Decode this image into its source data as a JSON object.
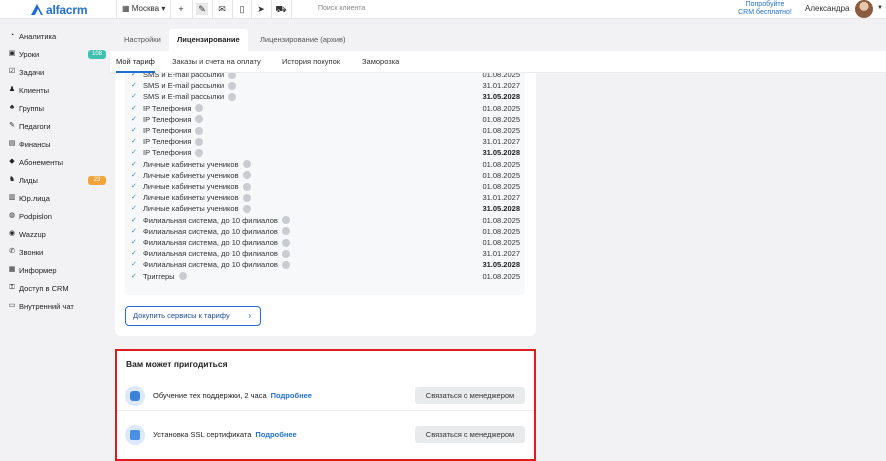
{
  "header": {
    "logo_text": "alfacrm",
    "city": "Москва ▾",
    "search_placeholder": "Поиск клиента",
    "promo_line1": "Попробуйте",
    "promo_line2": "CRM бесплатно!",
    "user_name": "Александра",
    "icons": [
      "plus-icon",
      "wrench-icon",
      "mail-icon",
      "phone-icon",
      "telegram-icon",
      "cart-icon"
    ]
  },
  "sidebar": {
    "items": [
      {
        "label": "Аналитика",
        "icon": "analytics-icon",
        "glyph": "◔"
      },
      {
        "label": "Уроки",
        "icon": "lessons-icon",
        "glyph": "▣",
        "badge": "108",
        "badge_color": "#3ec1b0"
      },
      {
        "label": "Задачи",
        "icon": "tasks-icon",
        "glyph": "☑"
      },
      {
        "label": "Клиенты",
        "icon": "clients-icon",
        "glyph": "♟"
      },
      {
        "label": "Группы",
        "icon": "groups-icon",
        "glyph": "♣"
      },
      {
        "label": "Педагоги",
        "icon": "teachers-icon",
        "glyph": "✎"
      },
      {
        "label": "Финансы",
        "icon": "finance-icon",
        "glyph": "▤"
      },
      {
        "label": "Абонементы",
        "icon": "subscriptions-icon",
        "glyph": "◆"
      },
      {
        "label": "Лиды",
        "icon": "leads-icon",
        "glyph": "♞",
        "badge": "23",
        "badge_color": "#f2a53a"
      },
      {
        "label": "Юр.лица",
        "icon": "legal-entities-icon",
        "glyph": "▥"
      },
      {
        "label": "Podpislon",
        "icon": "podpislon-icon",
        "glyph": "◍"
      },
      {
        "label": "Wazzup",
        "icon": "wazzup-icon",
        "glyph": "◉"
      },
      {
        "label": "Звонки",
        "icon": "calls-icon",
        "glyph": "✆"
      },
      {
        "label": "Информер",
        "icon": "informer-icon",
        "glyph": "▦"
      },
      {
        "label": "Доступ в CRM",
        "icon": "access-icon",
        "glyph": "⚿"
      },
      {
        "label": "Внутренний чат",
        "icon": "chat-icon",
        "glyph": "▭"
      }
    ]
  },
  "tabs": [
    {
      "label": "Настройки",
      "active": false
    },
    {
      "label": "Лицензирование",
      "active": true
    },
    {
      "label": "Лицензирование (архив)",
      "active": false
    }
  ],
  "subtabs": [
    {
      "label": "Мой тариф",
      "active": true
    },
    {
      "label": "Заказы и счета на оплату",
      "active": false
    },
    {
      "label": "История покупок",
      "active": false
    },
    {
      "label": "Заморозка",
      "active": false
    }
  ],
  "services": [
    {
      "name": "SMS и E-mail рассылки",
      "date": "01.08.2025",
      "bold": false
    },
    {
      "name": "SMS и E-mail рассылки",
      "date": "31.01.2027",
      "bold": false
    },
    {
      "name": "SMS и E-mail рассылки",
      "date": "31.05.2028",
      "bold": true
    },
    {
      "name": "IP Телефония",
      "date": "01.08.2025",
      "bold": false
    },
    {
      "name": "IP Телефония",
      "date": "01.08.2025",
      "bold": false
    },
    {
      "name": "IP Телефония",
      "date": "01.08.2025",
      "bold": false
    },
    {
      "name": "IP Телефония",
      "date": "31.01.2027",
      "bold": false
    },
    {
      "name": "IP Телефония",
      "date": "31.05.2028",
      "bold": true
    },
    {
      "name": "Личные кабинеты учеников",
      "date": "01.08.2025",
      "bold": false
    },
    {
      "name": "Личные кабинеты учеников",
      "date": "01.08.2025",
      "bold": false
    },
    {
      "name": "Личные кабинеты учеников",
      "date": "01.08.2025",
      "bold": false
    },
    {
      "name": "Личные кабинеты учеников",
      "date": "31.01.2027",
      "bold": false
    },
    {
      "name": "Личные кабинеты учеников",
      "date": "31.05.2028",
      "bold": true
    },
    {
      "name": "Филиальная система, до 10 филиалов",
      "date": "01.08.2025",
      "bold": false
    },
    {
      "name": "Филиальная система, до 10 филиалов",
      "date": "01.08.2025",
      "bold": false
    },
    {
      "name": "Филиальная система, до 10 филиалов",
      "date": "01.08.2025",
      "bold": false
    },
    {
      "name": "Филиальная система, до 10 филиалов",
      "date": "31.01.2027",
      "bold": false
    },
    {
      "name": "Филиальная система, до 10 филиалов",
      "date": "31.05.2028",
      "bold": true
    },
    {
      "name": "Триггеры",
      "date": "01.08.2025",
      "bold": false
    }
  ],
  "buy_button_label": "Докупить сервисы к тарифу",
  "recommend": {
    "title": "Вам может пригодиться",
    "items": [
      {
        "text": "Обучение тех поддержки, 2 часа",
        "link": "Подробнее",
        "button": "Связаться с менеджером",
        "icon": "support-training-icon"
      },
      {
        "text": "Установка SSL сертификата",
        "link": "Подробнее",
        "button": "Связаться с менеджером",
        "icon": "ssl-certificate-icon"
      }
    ]
  },
  "colors": {
    "accent": "#1f6fd1",
    "highlight_border": "#e01b1b"
  }
}
